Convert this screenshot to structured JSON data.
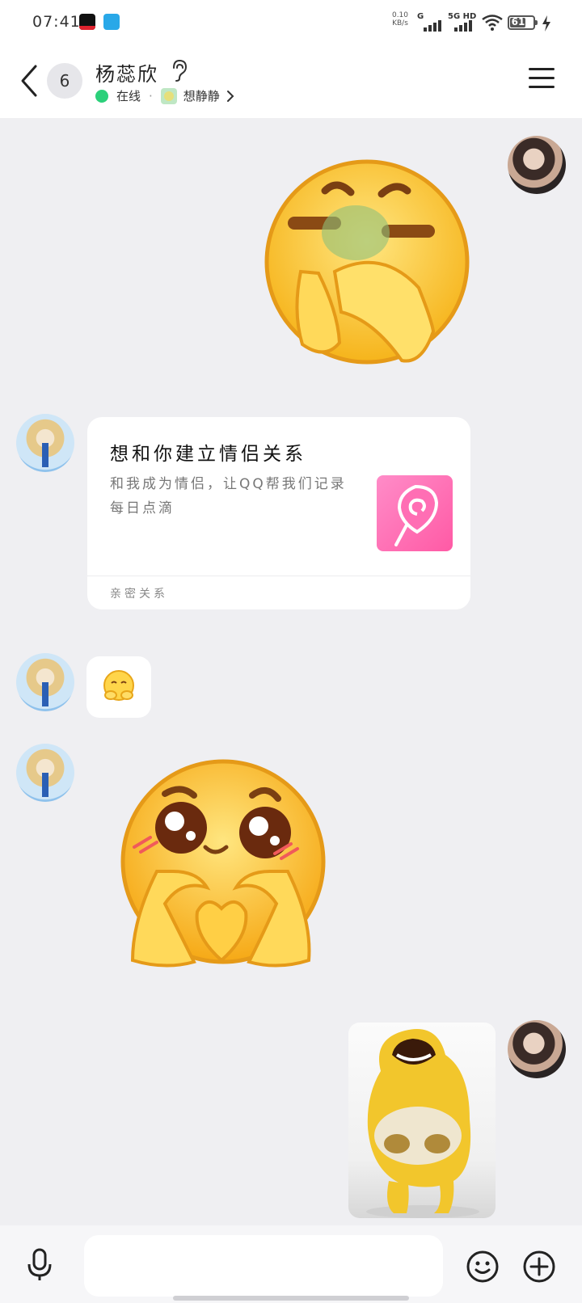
{
  "status_bar": {
    "time": "07:41",
    "net_speed": "0.10\nKB/s",
    "sim1_label": "G",
    "sim2_label": "5G HD",
    "battery_level": "61",
    "charging": true
  },
  "header": {
    "unread_count": "6",
    "contact_name": "杨蕊欣",
    "online_status": "在线",
    "mood_status": "想静静"
  },
  "messages": [
    {
      "sender": "self",
      "type": "sticker",
      "sticker": "covering-mouth-nauseated-emoji"
    },
    {
      "sender": "peer",
      "type": "card",
      "title": "想和你建立情侣关系",
      "description": "和我成为情侣，让QQ帮我们记录每日点滴",
      "footer": "亲密关系",
      "thumbnail_icon": "lollipop-icon"
    },
    {
      "sender": "peer",
      "type": "small-emoji",
      "sticker": "hugging-emoji"
    },
    {
      "sender": "peer",
      "type": "sticker",
      "sticker": "heart-hands-emoji"
    },
    {
      "sender": "self",
      "type": "image",
      "image": "laughing-yellow-creature"
    }
  ],
  "input": {
    "placeholder": ""
  },
  "colors": {
    "background": "#efeff2",
    "online_green": "#2bd07a",
    "card_thumb_pink": "#ff5aa5"
  }
}
